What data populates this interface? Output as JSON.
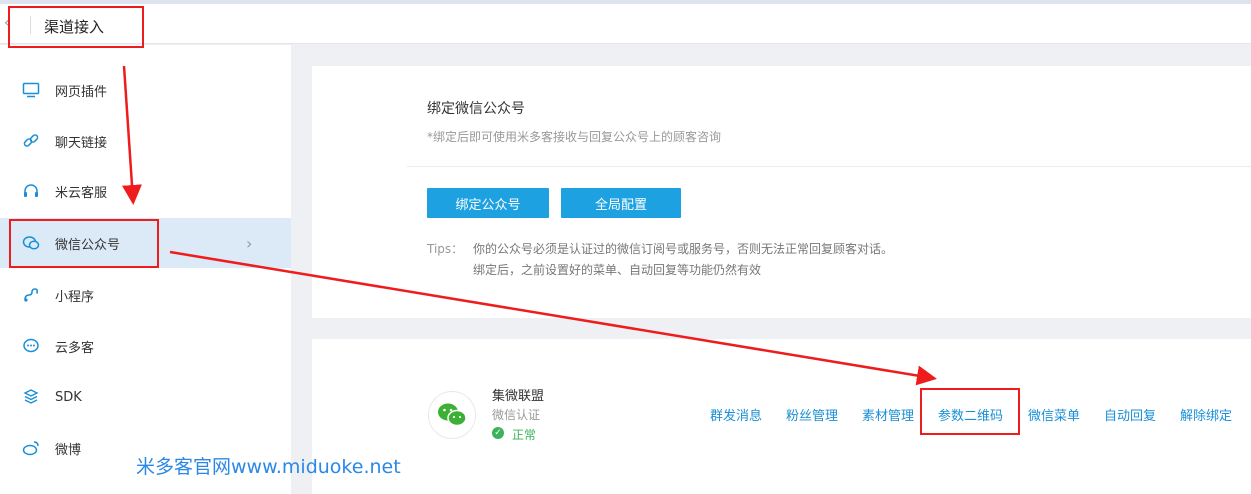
{
  "header": {
    "back_icon": "chevron-left-icon",
    "title": "渠道接入"
  },
  "sidebar": {
    "items": [
      {
        "label": "网页插件",
        "icon": "monitor-icon"
      },
      {
        "label": "聊天链接",
        "icon": "link-icon"
      },
      {
        "label": "米云客服",
        "icon": "headset-icon"
      },
      {
        "label": "微信公众号",
        "icon": "wechat-bubble-icon",
        "active": true
      },
      {
        "label": "小程序",
        "icon": "miniprogram-icon"
      },
      {
        "label": "云多客",
        "icon": "chat-dots-icon"
      },
      {
        "label": "SDK",
        "icon": "sdk-layers-icon"
      },
      {
        "label": "微博",
        "icon": "weibo-icon"
      }
    ],
    "active_color": "#dceaf7"
  },
  "bind_card": {
    "title": "绑定微信公众号",
    "subtitle": "*绑定后即可使用米多客接收与回复公众号上的顾客咨询",
    "bind_button": "绑定公众号",
    "global_button": "全局配置",
    "tips_label": "Tips：",
    "tips_line1": "你的公众号必须是认证过的微信订阅号或服务号，否则无法正常回复顾客对话。",
    "tips_line2": "绑定后，之前设置好的菜单、自动回复等功能仍然有效",
    "button_color": "#1ea1e0"
  },
  "account_card": {
    "avatar_icon": "wechat-logo-icon",
    "name": "集微联盟",
    "type": "微信认证",
    "status": "正常",
    "status_color": "#3cb35a",
    "actions": [
      "群发消息",
      "粉丝管理",
      "素材管理",
      "参数二维码",
      "微信菜单",
      "自动回复",
      "解除绑定"
    ],
    "link_color": "#1a8fd6"
  },
  "annotations": {
    "highlight_color": "#ee1c1c",
    "watermark": "米多客官网www.miduoke.net"
  }
}
